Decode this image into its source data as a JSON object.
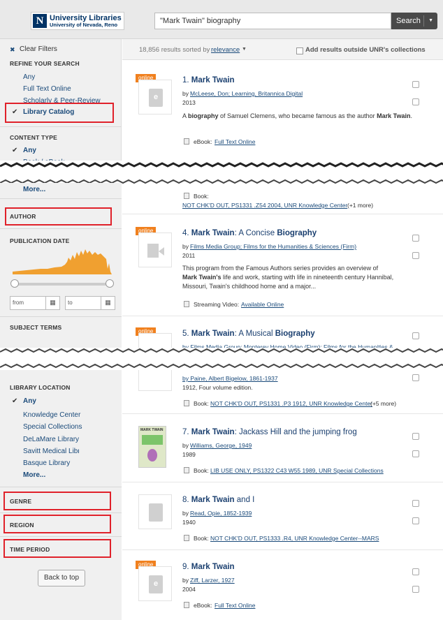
{
  "header": {
    "logo_title": "University Libraries",
    "logo_subtitle": "University of Nevada, Reno",
    "search_value": "\"Mark Twain\" biography",
    "search_button": "Search"
  },
  "results_bar": {
    "count_text": "18,856 results sorted by",
    "sort_value": "relevance",
    "outside_label": "Add results outside UNR's collections"
  },
  "sidebar": {
    "clear_filters": "Clear Filters",
    "refine_heading": "REFINE YOUR SEARCH",
    "refine_items": [
      "Any",
      "Full Text Online",
      "Scholarly & Peer-Review",
      "Library Catalog"
    ],
    "content_type_heading": "CONTENT TYPE",
    "content_type_items": [
      "Any",
      "Book / eBook"
    ],
    "more": "More...",
    "author_heading": "AUTHOR",
    "pubdate_heading": "PUBLICATION DATE",
    "from_placeholder": "from",
    "to_placeholder": "to",
    "subject_heading": "SUBJECT TERMS",
    "location_heading": "LIBRARY LOCATION",
    "location_items": [
      "Any",
      "Knowledge Center",
      "Special Collections",
      "DeLaMare Library",
      "Savitt Medical Library",
      "Basque Library"
    ],
    "location_more": "More...",
    "genre_heading": "GENRE",
    "region_heading": "REGION",
    "time_heading": "TIME PERIOD",
    "back_to_top": "Back to top"
  },
  "badge_online": "online",
  "results": [
    {
      "title_num": "1. ",
      "title_bold": "Mark Twain",
      "title_rest": "",
      "by": "by ",
      "authors": "McLeese, Don; Learning, Britannica Digital",
      "year": "2013",
      "desc_pre": "A ",
      "desc_b1": "biography",
      "desc_mid": " of Samuel Clemens, who became famous as the author ",
      "desc_b2": "Mark Twain",
      "desc_end": ".",
      "fmt_label": "eBook: ",
      "fmt_link": "Full Text Online"
    },
    {
      "fmt_label": "Book: ",
      "fmt_link": "NOT CHK'D OUT, PS1331 .Z54 2004, UNR Knowledge Center",
      "fmt_extra": " (+1 more)"
    },
    {
      "title_num": "4. ",
      "title_bold": "Mark Twain",
      "title_rest": ": A Concise ",
      "title_bold2": "Biography",
      "by": "by ",
      "authors": "Films Media Group; Films for the Humanities & Sciences (Firm)",
      "year": "2011",
      "desc_l1": "This program from the Famous Authors series provides an overview of",
      "desc_l2_b": "Mark Twain's",
      "desc_l2": " life and work, starting with life in nineteenth century Hannibal,",
      "desc_l3": "Missouri, Twain's childhood home and a major...",
      "fmt_label": "Streaming Video: ",
      "fmt_link": "Available Online"
    },
    {
      "title_num": "5. ",
      "title_bold": "Mark Twain",
      "title_rest": ": A Musical ",
      "title_bold2": "Biography",
      "authors": "by Films Media Group; Monterey Home Video (Firm); Films for the Humanities &"
    },
    {
      "authors": "by Paine, Albert Bigelow, 1861-1937",
      "year": "1912, Four volume edition.",
      "fmt_label": "Book: ",
      "fmt_link": "NOT CHK'D OUT, PS1331 .P3 1912, UNR Knowledge Center",
      "fmt_extra": " (+5 more)"
    },
    {
      "title_num": "7. ",
      "title_bold": "Mark Twain",
      "title_rest": ": Jackass Hill and the jumping frog",
      "by": "by ",
      "authors": "Williams, George, 1949",
      "year": "1989",
      "fmt_label": "Book: ",
      "fmt_link": "LIB USE ONLY, PS1322 C43 W55 1989, UNR Special Collections",
      "cover_text": "MARK TWAIN"
    },
    {
      "title_num": "8. ",
      "title_bold": "Mark Twain",
      "title_rest": " and I",
      "by": "by ",
      "authors": "Read, Opie, 1852-1939",
      "year": "1940",
      "fmt_label": "Book: ",
      "fmt_link": "NOT CHK'D OUT, PS1333 .R4, UNR Knowledge Center--MARS"
    },
    {
      "title_num": "9. ",
      "title_bold": "Mark Twain",
      "title_rest": "",
      "by": "by ",
      "authors": "Ziff, Larzer, 1927",
      "year": "2004",
      "fmt_label": "eBook: ",
      "fmt_link": "Full Text Online"
    }
  ],
  "colors": {
    "accent_orange": "#f0801e",
    "highlight_red": "#e0212a",
    "link_blue": "#1a4a7a",
    "search_button": "#4a4a4a"
  }
}
